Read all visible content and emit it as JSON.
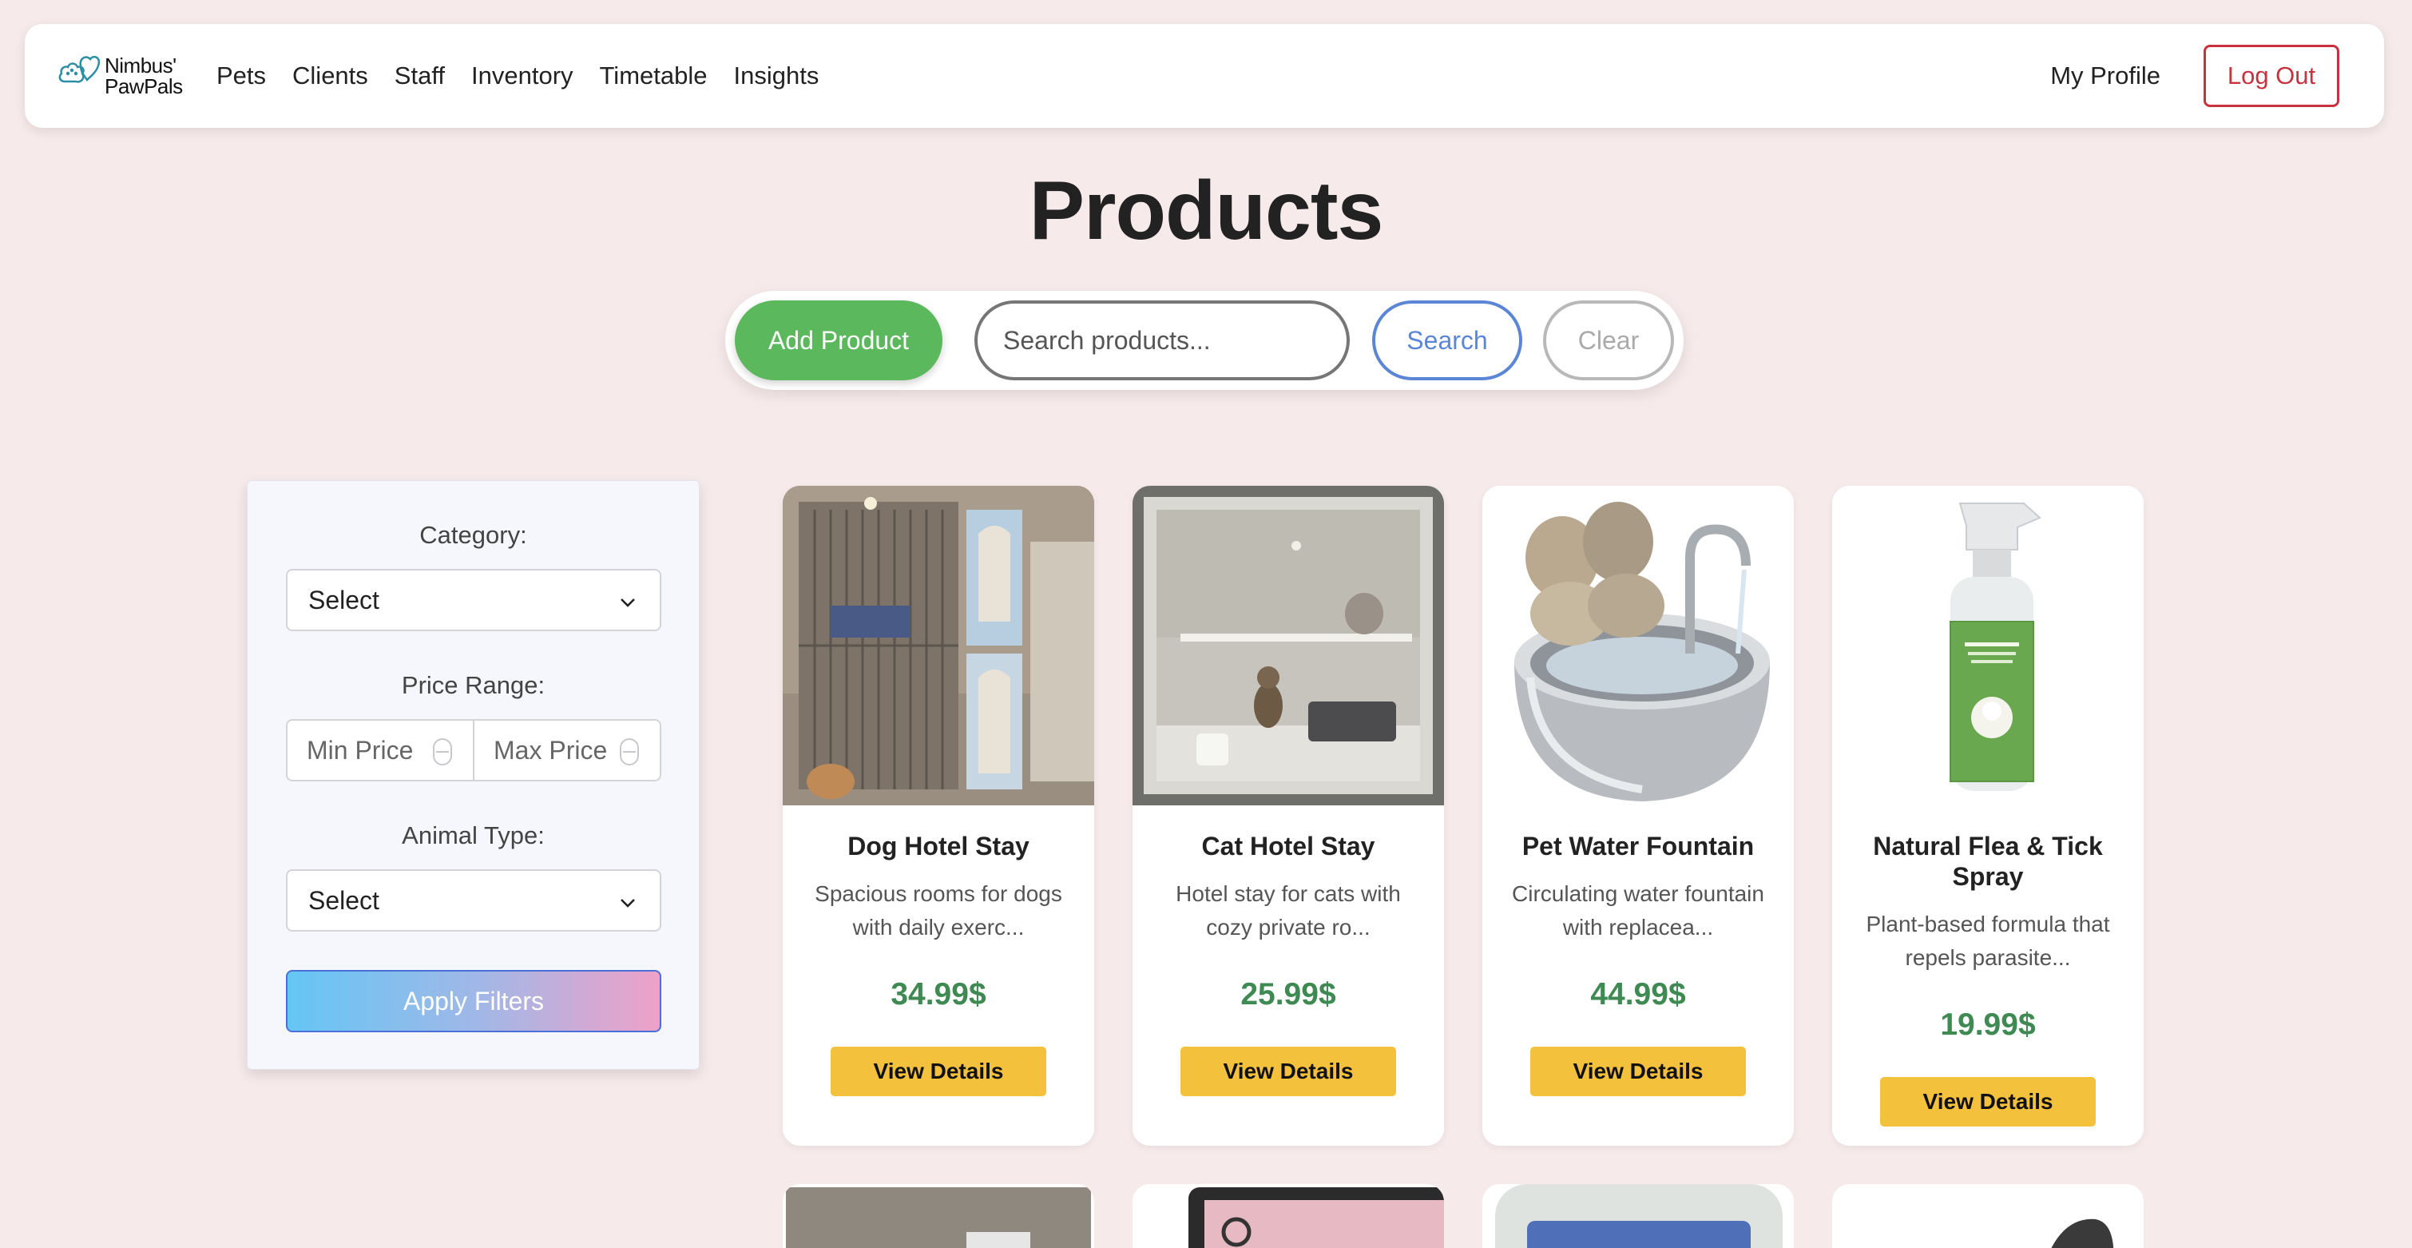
{
  "brand": {
    "line1": "Nimbus'",
    "line2": "PawPals"
  },
  "nav": {
    "links": [
      "Pets",
      "Clients",
      "Staff",
      "Inventory",
      "Timetable",
      "Insights"
    ],
    "profile": "My Profile",
    "logout": "Log Out"
  },
  "page": {
    "title": "Products"
  },
  "actions": {
    "add_label": "Add Product",
    "search_placeholder": "Search products...",
    "search_label": "Search",
    "clear_label": "Clear"
  },
  "filters": {
    "category_label": "Category:",
    "category_value": "Select",
    "price_label": "Price Range:",
    "min_placeholder": "Min Price",
    "max_placeholder": "Max Price",
    "animal_label": "Animal Type:",
    "animal_value": "Select",
    "apply_label": "Apply Filters"
  },
  "products": [
    {
      "title": "Dog Hotel Stay",
      "desc": "Spacious rooms for dogs with daily exerc...",
      "price": "34.99$",
      "button": "View Details"
    },
    {
      "title": "Cat Hotel Stay",
      "desc": "Hotel stay for cats with cozy private ro...",
      "price": "25.99$",
      "button": "View Details"
    },
    {
      "title": "Pet Water Fountain",
      "desc": "Circulating water fountain with replacea...",
      "price": "44.99$",
      "button": "View Details"
    },
    {
      "title": "Natural Flea & Tick Spray",
      "desc": "Plant-based formula that repels parasite...",
      "price": "19.99$",
      "button": "View Details"
    }
  ],
  "colors": {
    "background": "#f7eaeb",
    "primary_green": "#5cb85c",
    "price_green": "#3e8a52",
    "button_yellow": "#f4c13d",
    "logout_red": "#c8323f"
  }
}
